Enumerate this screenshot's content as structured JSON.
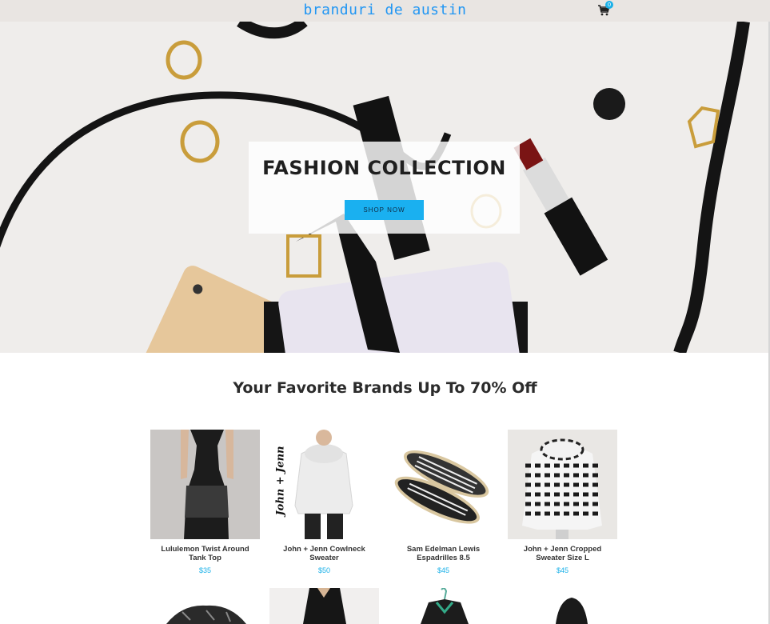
{
  "header": {
    "brand": "branduri de austin",
    "cart_count": "0",
    "cart_icon": "shopping-cart-icon"
  },
  "hero": {
    "title": "FASHION COLLECTION",
    "button_label": "SHOP NOW"
  },
  "section": {
    "title": "Your Favorite Brands Up To 70% Off"
  },
  "products": [
    {
      "name": "Lululemon Twist Around Tank Top",
      "price": "$35"
    },
    {
      "name": "John + Jenn Cowlneck Sweater",
      "price": "$50"
    },
    {
      "name": "Sam Edelman Lewis Espadrilles 8.5",
      "price": "$45"
    },
    {
      "name": "John + Jenn Cropped Sweater Size L",
      "price": "$45"
    }
  ],
  "product_brand_overlay": "John + Jenn",
  "colors": {
    "accent": "#1ab0f0",
    "brand_text": "#2196f3",
    "topbar": "#e9e5e2"
  }
}
